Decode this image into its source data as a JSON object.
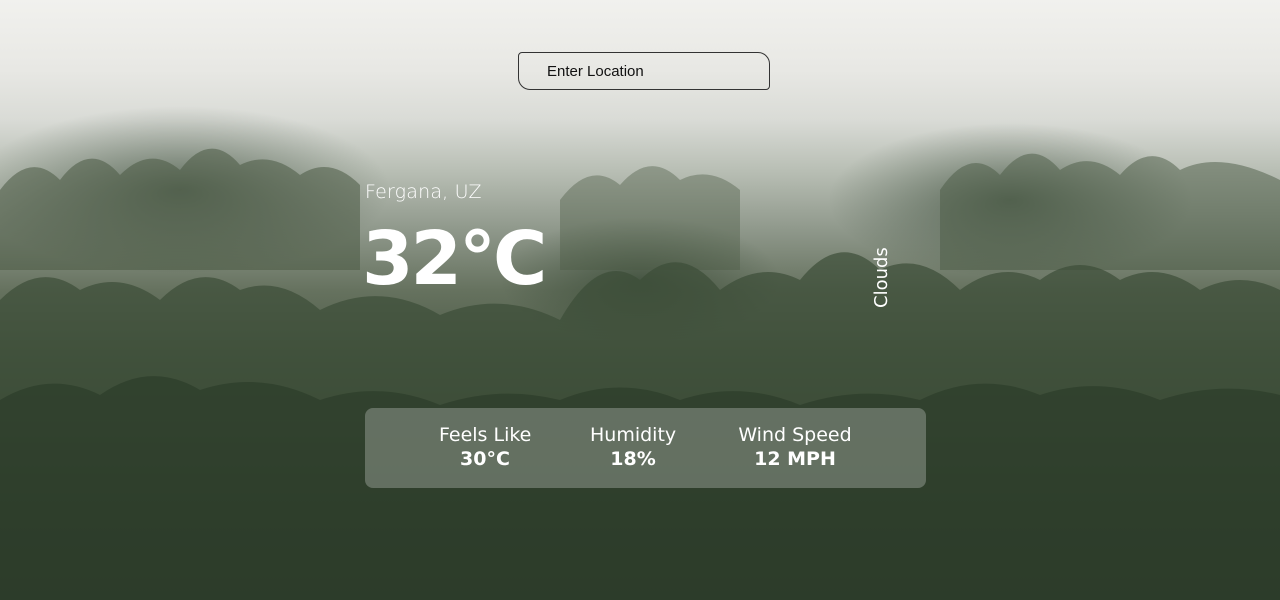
{
  "search": {
    "placeholder": "Enter Location"
  },
  "weather": {
    "location": "Fergana, UZ",
    "temperature": "32°C",
    "description": "Clouds"
  },
  "stats": {
    "feels_like": {
      "label": "Feels Like",
      "value": "30°C"
    },
    "humidity": {
      "label": "Humidity",
      "value": "18%"
    },
    "wind_speed": {
      "label": "Wind Speed",
      "value": "12 MPH"
    }
  },
  "background": {
    "scene": "misty-forest",
    "colors": {
      "fog": "#f1f1ee",
      "forest_dark": "#2b3a29",
      "text": "#ffffff"
    }
  }
}
